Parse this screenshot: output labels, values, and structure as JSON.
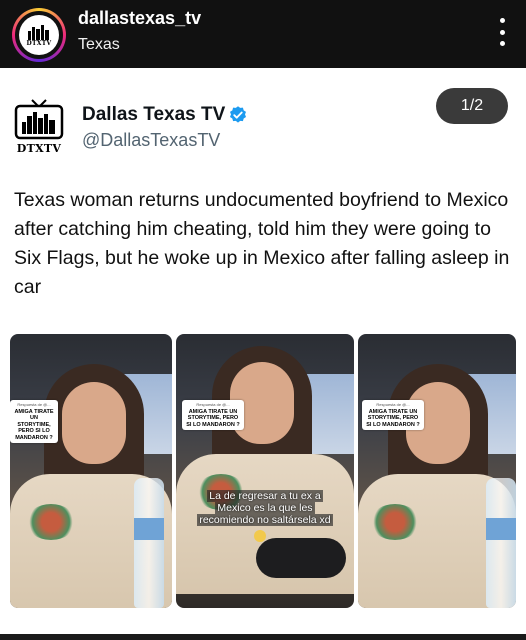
{
  "ig_header": {
    "username": "dallastexas_tv",
    "location": "Texas",
    "avatar_logo_text": "DTXTV"
  },
  "tweet": {
    "display_name": "Dallas Texas TV",
    "handle": "@DallasTexasTV",
    "avatar_logo_text": "DTXTV",
    "verified": true,
    "page_indicator": "1/2",
    "text": "Texas woman returns undocumented boyfriend to Mexico after catching him cheating, told him they were going to Six Flags, but he woke up in Mexico after falling asleep in car"
  },
  "video_frames": [
    {
      "caption_header": "Respuesta de @...",
      "caption": "AMIGA TIRATE UN STORYTIME, PERO SI LO MANDARON ?"
    },
    {
      "caption_header": "Respuesta de @...",
      "caption": "AMIGA TIRATE UN STORYTIME, PERO SI LO MANDARON ?",
      "subtitle_line1": "La de regresar a tu ex a",
      "subtitle_line2": "Mexico es la que les",
      "subtitle_line3": "recomiendo no saltársela xd"
    },
    {
      "caption_header": "Respuesta de @...",
      "caption": "AMIGA TIRATE UN STORYTIME, PERO SI LO MANDARON ?"
    }
  ],
  "colors": {
    "header_bg": "#111111",
    "verified_blue": "#1d9bf0",
    "badge_bg": "#3a3a3a",
    "handle_gray": "#536471"
  }
}
